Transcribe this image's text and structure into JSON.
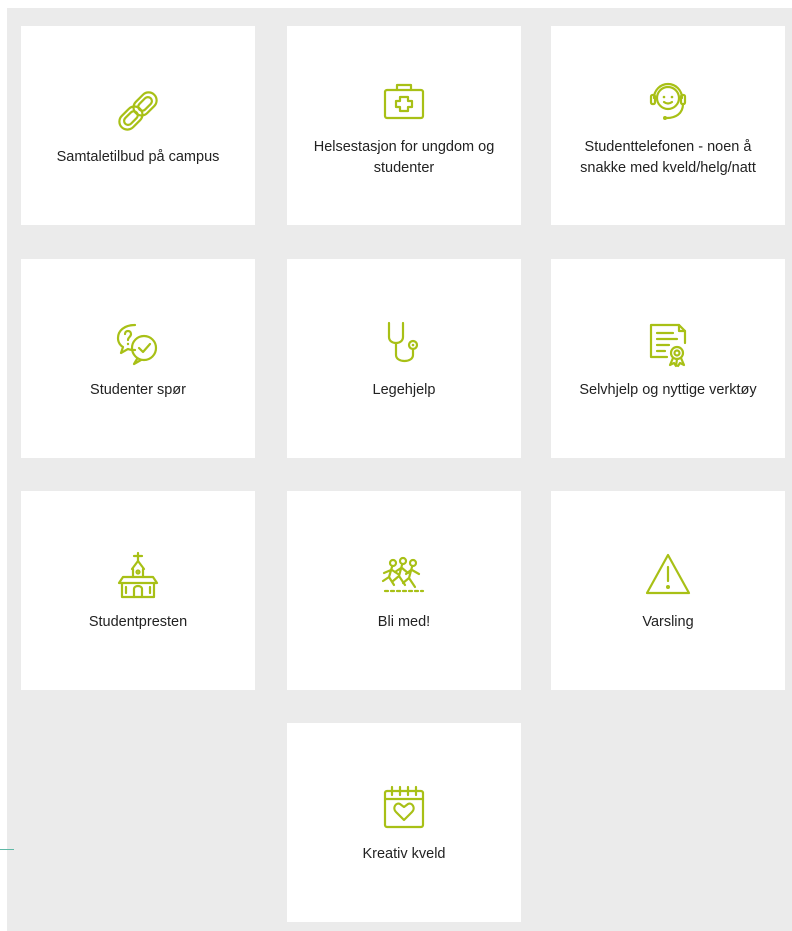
{
  "accent_color": "#a8c016",
  "tiles": [
    {
      "label": "Samtaletilbud på campus",
      "icon": "chain-link-icon"
    },
    {
      "label": "Helsestasjon for ungdom og studenter",
      "icon": "first-aid-kit-icon"
    },
    {
      "label": "Studenttelefonen - noen å snakke med kveld/helg/natt",
      "icon": "headset-person-icon"
    },
    {
      "label": "Studenter spør",
      "icon": "question-chat-bubbles-icon"
    },
    {
      "label": "Legehjelp",
      "icon": "stethoscope-icon"
    },
    {
      "label": "Selvhjelp og nyttige verktøy",
      "icon": "certificate-icon"
    },
    {
      "label": "Studentpresten",
      "icon": "church-icon"
    },
    {
      "label": "Bli med!",
      "icon": "running-group-icon"
    },
    {
      "label": "Varsling",
      "icon": "warning-triangle-icon"
    },
    {
      "label": "Kreativ kveld",
      "icon": "calendar-heart-icon"
    }
  ]
}
